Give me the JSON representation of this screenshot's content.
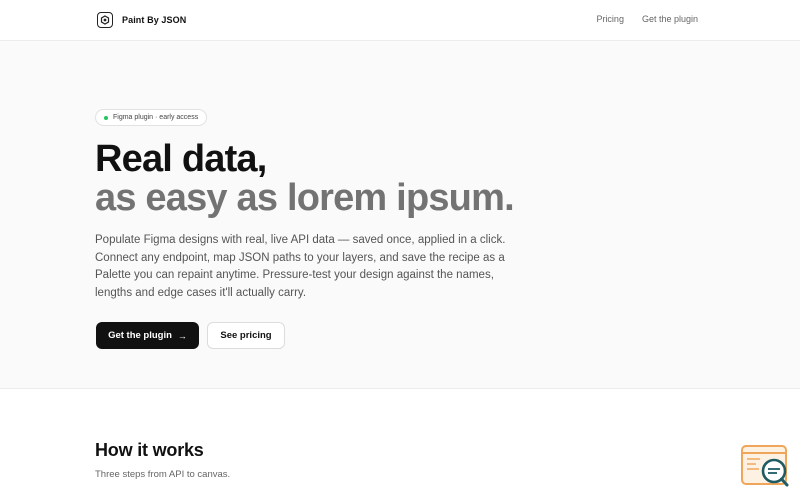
{
  "nav": {
    "brand": "Paint By JSON",
    "links": [
      "Pricing",
      "Get the plugin"
    ]
  },
  "hero": {
    "badge": "Figma plugin · early access",
    "title_line1": "Real data,",
    "title_line2": "as easy as lorem ipsum.",
    "lead": "Populate Figma designs with real, live API data — saved once, applied in a click. Connect any endpoint, map JSON paths to your layers, and save the recipe as a Palette you can repaint anytime. Pressure-test your design against the names, lengths and edge cases it'll actually carry.",
    "primary_cta": "Get the plugin",
    "secondary_cta": "See pricing"
  },
  "how": {
    "title": "How it works",
    "subtitle": "Three steps from API to canvas."
  },
  "icons": {
    "brand": "palette-logo-icon",
    "cta_arrow": "arrow-right-icon",
    "corner": "inspector-search-icon"
  },
  "colors": {
    "accent_dark": "#111111",
    "muted_heading": "#737373",
    "badge_dot": "#22c55e",
    "widget_orange": "#f0a65a",
    "widget_teal": "#1f5b63"
  }
}
